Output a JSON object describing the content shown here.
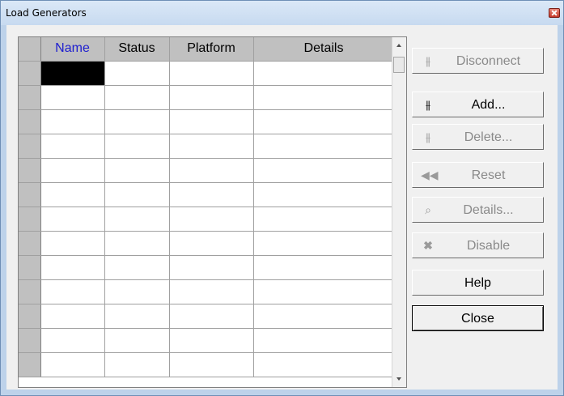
{
  "window": {
    "title": "Load Generators"
  },
  "grid": {
    "columns": [
      "Name",
      "Status",
      "Platform",
      "Details"
    ],
    "row_count": 13
  },
  "buttons": {
    "disconnect": {
      "label": "Disconnect",
      "icon": "disconnect-icon",
      "enabled": false
    },
    "add": {
      "label": "Add...",
      "icon": "add-generator-icon",
      "enabled": true
    },
    "delete": {
      "label": "Delete...",
      "icon": "delete-generator-icon",
      "enabled": false
    },
    "reset": {
      "label": "Reset",
      "icon": "rewind-icon",
      "enabled": false
    },
    "details": {
      "label": "Details...",
      "icon": "details-icon",
      "enabled": false
    },
    "disable": {
      "label": "Disable",
      "icon": "x-icon",
      "enabled": false
    },
    "help": {
      "label": "Help"
    },
    "close": {
      "label": "Close"
    }
  }
}
